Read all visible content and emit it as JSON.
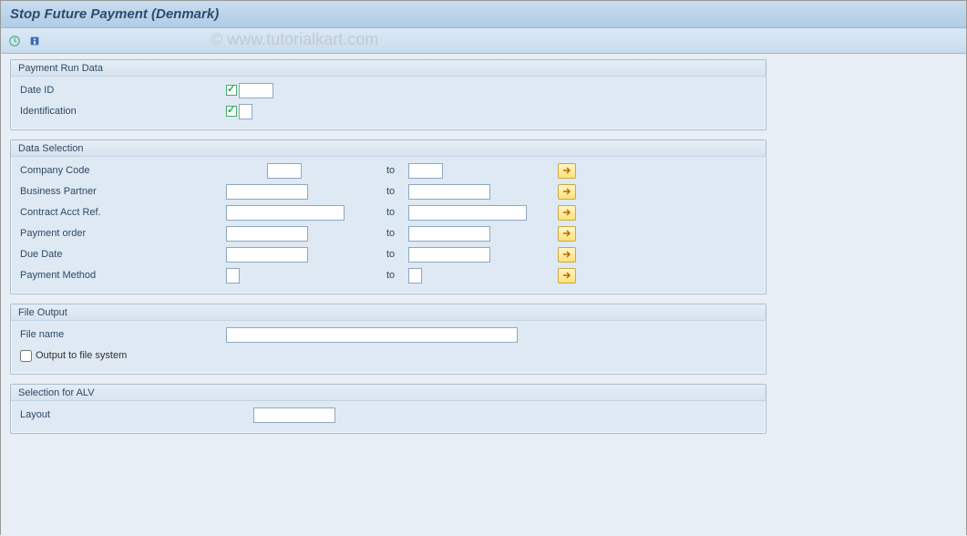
{
  "page_title": "Stop Future Payment (Denmark)",
  "watermark": "© www.tutorialkart.com",
  "toolbar": {
    "execute_tooltip": "Execute",
    "info_tooltip": "Information"
  },
  "groups": {
    "payment_run": {
      "title": "Payment Run Data",
      "date_id_label": "Date ID",
      "date_id_value": "",
      "identification_label": "Identification",
      "identification_value": ""
    },
    "data_selection": {
      "title": "Data Selection",
      "to_label": "to",
      "company_code": {
        "label": "Company Code",
        "from": "",
        "to": ""
      },
      "business_partner": {
        "label": "Business Partner",
        "from": "",
        "to": ""
      },
      "contract_acct_ref": {
        "label": "Contract Acct Ref.",
        "from": "",
        "to": ""
      },
      "payment_order": {
        "label": "Payment order",
        "from": "",
        "to": ""
      },
      "due_date": {
        "label": "Due Date",
        "from": "",
        "to": ""
      },
      "payment_method": {
        "label": "Payment Method",
        "from": "",
        "to": ""
      }
    },
    "file_output": {
      "title": "File Output",
      "file_name_label": "File name",
      "file_name_value": "",
      "output_fs_label": "Output to file system",
      "output_fs_checked": false
    },
    "alv": {
      "title": "Selection for ALV",
      "layout_label": "Layout",
      "layout_value": ""
    }
  }
}
